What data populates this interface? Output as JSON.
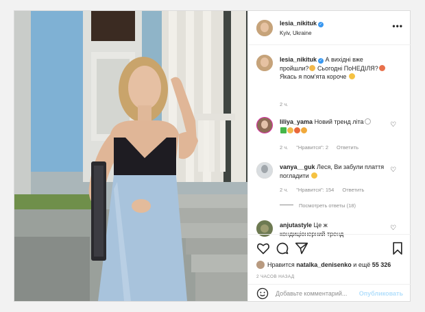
{
  "post": {
    "username": "lesia_nikituk",
    "location": "Kyiv, Ukraine",
    "more_label": "•••"
  },
  "comments": [
    {
      "username": "lesia_nikituk",
      "text": "А вихідні вже пройшли?😩 Сьогодні ПоНЕДІЛЯ?🥵Якась я пом'ята короче 😂",
      "text_parts": [
        "А вихідні вже пройшли?",
        "Сьогодні ПоНЕДІЛЯ?",
        "Якась я пом'ята короче"
      ],
      "time": "2 ч."
    },
    {
      "username": "liliya_yama",
      "text": "Новий тренд літа",
      "time": "2 ч.",
      "likes": "\"Нравится\": 2",
      "reply": "Ответить"
    },
    {
      "username": "vanya__guk",
      "text": "Леся, Ви забули плаття погладити",
      "time": "2 ч.",
      "likes": "\"Нравится\": 154",
      "reply": "Ответить",
      "view_replies": "Посмотреть ответы (18)"
    },
    {
      "username": "anjutastyle",
      "text": "Це ж",
      "text_cut": "кондиціонерний тренд"
    }
  ],
  "likes": {
    "prefix": "Нравится",
    "user": "natalka_denisenko",
    "middle": "и ещё",
    "count": "55 326"
  },
  "timestamp": "2 ЧАСОВ НАЗАД",
  "add_comment": {
    "placeholder": "Добавьте комментарий...",
    "publish": "Опубликовать"
  },
  "icons": {
    "verified": "verified-badge-icon",
    "heart": "heart-icon",
    "comment": "comment-icon",
    "share": "share-icon",
    "save": "bookmark-icon",
    "emoji": "smile-icon",
    "accent": "#3897f0"
  }
}
